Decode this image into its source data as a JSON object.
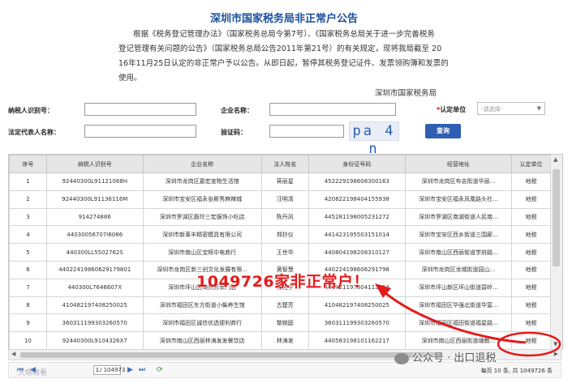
{
  "notice": {
    "title": "深圳市国家税务局非正常户公告",
    "line1": "根据《税务登记管理办法》（国家税务总局令第7号）、《国家税务总局关于进一步完善税务",
    "line2": "登记管理有关问题的公告》（国家税务总局公告2011年第21号）的有关规定，现将我局截至 20",
    "line3": "16年11月25日认定的非正常户予以公告。从即日起，暂停其税务登记证件、发票领购簿和发票的",
    "line4": "使用。",
    "signature": "深圳市国家税务局"
  },
  "form": {
    "taxpayer_id_label": "纳税人识别号：",
    "company_name_label": "企业名称：",
    "legal_rep_label": "法定代表人名称：",
    "captcha_label": "验证码：",
    "unit_label": "认定单位",
    "unit_required": "*",
    "unit_placeholder": "-请选择-",
    "captcha_text": "pa 4 n",
    "query_button": "查询"
  },
  "table": {
    "headers": [
      "序号",
      "纳税人识别号",
      "企业名称",
      "法人姓名",
      "身份证号码",
      "经营地址",
      "认定单位"
    ],
    "rows": [
      [
        "1",
        "92440300L91121088H",
        "深圳市龙岗区嘉宏宠物生活馆",
        "蒋丽星",
        "452229198608300163",
        "深圳市龙岗区布吉街道华丽...",
        "地税"
      ],
      [
        "2",
        "92440300L91136116M",
        "深圳市宝安区福永张斯秀麻辣城",
        "汪明清",
        "420822198404155938",
        "深圳市宝安区福永凤凰路头社...",
        "地税"
      ],
      [
        "3",
        "914274886",
        "深圳市罗湖区磊玲三宏服饰小吃店",
        "陈丹凤",
        "445281198005231272",
        "深圳市罗湖区南湖街道人民南...",
        "地税"
      ],
      [
        "4",
        "44030056707I6086",
        "深圳市新莱丰精密模具有限公司",
        "郑抄仪",
        "441423195503151014",
        "深圳市宝安区西乡街道三围廊...",
        "地税"
      ],
      [
        "5",
        "440300LL5502762S",
        "深圳市南山区宝辉中电商行",
        "王世华",
        "440804198208310127",
        "深圳市南山区西丽街道学府路...",
        "地税"
      ],
      [
        "6",
        "44022419860629179801",
        "深圳市龙岗区新三创文化发展有限...",
        "黄智慧",
        "440224198606291798",
        "深圳市龙岗区龙城街道园山...",
        "地税"
      ],
      [
        "7",
        "440300L7646607X",
        "深圳市坪山区琦然芳菲门店",
        "孙光宁",
        "441421197804113614",
        "深圳市坪山新区坪山街道碧岭...",
        "地税"
      ],
      [
        "8",
        "410482197408250025",
        "深圳市福田区东方街道小柴养生馆",
        "古楚芳",
        "410482197408250025",
        "深圳市福田区华强北街道华富...",
        "地税"
      ],
      [
        "9",
        "360311199303260570",
        "深圳市福田区诚信优选便利商行",
        "黎婉庭",
        "360311199303260570",
        "深圳市福田区福田街道福星路...",
        "地税"
      ],
      [
        "10",
        "92440300L9104326X7",
        "深圳市南山区西丽林涛发发餐饮店",
        "林涛发",
        "440583198101162217",
        "深圳市南山区西丽街道塘朗...",
        "地税"
      ]
    ]
  },
  "pager": {
    "page_no": "1",
    "total_pages": "/ 104973",
    "info": "每页 10 条, 共 1049726 条"
  },
  "annotation": "1049726家非正常户！",
  "watermark_left": "大眼睛看",
  "wechat_watermark": "公众号 · 出口退税",
  "colors": {
    "title_blue": "#1a4fa0",
    "button_blue": "#2f5fb3",
    "annotation_red": "#e41b1b"
  }
}
